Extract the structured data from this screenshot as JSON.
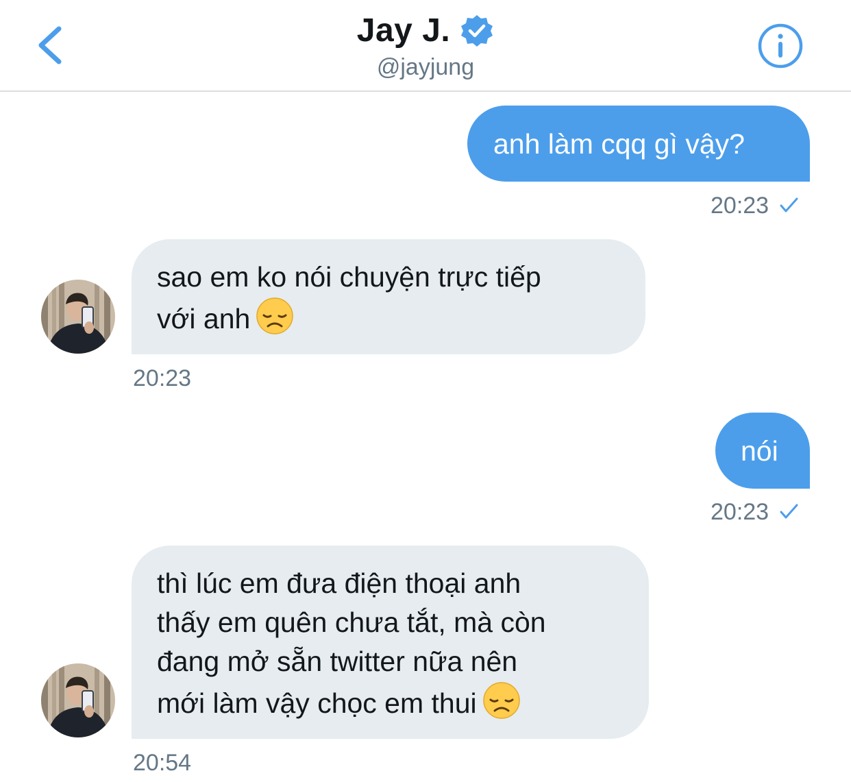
{
  "header": {
    "title": "Jay J.",
    "handle": "@jayjung",
    "back_icon": "chevron-left-icon",
    "verified_icon": "verified-badge-icon",
    "info_icon": "info-icon"
  },
  "colors": {
    "accent": "#4c9eeb",
    "received_bubble": "#e6ecf0",
    "meta_text": "#657786",
    "text": "#14171a"
  },
  "messages": [
    {
      "direction": "sent",
      "text": "anh làm cqq gì vậy?",
      "time": "20:23",
      "status_icon": "sent-check-icon"
    },
    {
      "direction": "received",
      "lines": [
        "sao em ko nói chuyện trực tiếp",
        "với anh"
      ],
      "emoji": "disappointed-face-emoji",
      "time": "20:23"
    },
    {
      "direction": "sent",
      "text": "nói",
      "time": "20:23",
      "status_icon": "sent-check-icon"
    },
    {
      "direction": "received",
      "lines": [
        "thì lúc em đưa điện thoại anh",
        "thấy em quên chưa tắt, mà còn",
        "đang mở sẵn twitter nữa nên",
        "mới làm vậy chọc em thui"
      ],
      "emoji": "disappointed-face-emoji",
      "time": "20:54"
    }
  ]
}
